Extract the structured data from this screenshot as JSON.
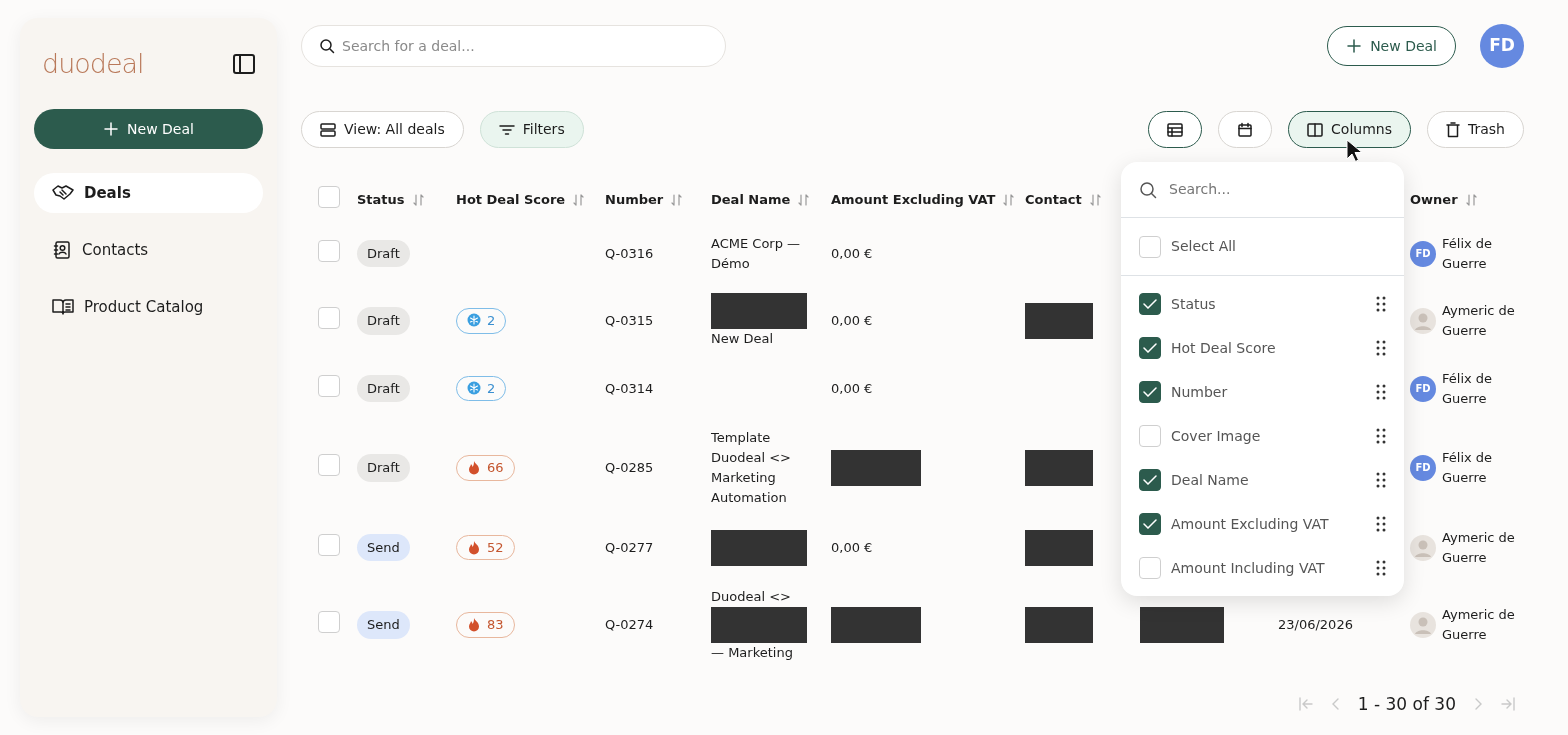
{
  "sidebar": {
    "logo": "duodeal",
    "new_deal": "New Deal",
    "items": [
      {
        "label": "Deals",
        "selected": true
      },
      {
        "label": "Contacts",
        "selected": false
      },
      {
        "label": "Product Catalog",
        "selected": false
      }
    ]
  },
  "search": {
    "placeholder": "Search for a deal..."
  },
  "new_deal": "New Deal",
  "user": {
    "initials": "FD"
  },
  "toolbar": {
    "view": "View: All deals",
    "filters": "Filters",
    "views": [
      {
        "kind": "table",
        "selected": true
      },
      {
        "kind": "calendar",
        "selected": false
      }
    ],
    "columns": {
      "label": "Columns",
      "selected": true
    },
    "trash": "Trash"
  },
  "table": {
    "header_checked": false,
    "columns": [
      "Status",
      "Hot Deal Score",
      "Number",
      "Deal Name",
      "Amount Excluding VAT",
      "Contact",
      "",
      "",
      "Owner"
    ],
    "rows": [
      {
        "selected": false,
        "status": {
          "kind": "draft",
          "label": "Draft"
        },
        "number": "Q-0316",
        "deal_name": [
          {
            "kind": "text",
            "text": "ACME Corp — Démo"
          }
        ],
        "amount": [
          {
            "kind": "text",
            "text": "0,00 €"
          }
        ],
        "contact": [],
        "column_7": [],
        "column_8": [],
        "owner": {
          "kind": "initials",
          "initials": "FD",
          "name": "Félix de Guerre"
        }
      },
      {
        "selected": false,
        "status": {
          "kind": "draft",
          "label": "Draft"
        },
        "score": {
          "kind": "cold",
          "value": "2"
        },
        "number": "Q-0315",
        "deal_name": [
          {
            "kind": "redaction"
          },
          {
            "kind": "text",
            "text": "New Deal"
          }
        ],
        "amount": [
          {
            "kind": "text",
            "text": "0,00 €"
          }
        ],
        "contact": [
          {
            "kind": "redaction"
          }
        ],
        "column_7": [],
        "column_8": [],
        "owner": {
          "kind": "photo",
          "name": "Aymeric de Guerre"
        }
      },
      {
        "selected": false,
        "status": {
          "kind": "draft",
          "label": "Draft"
        },
        "score": {
          "kind": "cold",
          "value": "2"
        },
        "number": "Q-0314",
        "deal_name": [],
        "amount": [
          {
            "kind": "text",
            "text": "0,00 €"
          }
        ],
        "contact": [],
        "column_7": [],
        "column_8": [],
        "owner": {
          "kind": "initials",
          "initials": "FD",
          "name": "Félix de Guerre"
        }
      },
      {
        "selected": false,
        "status": {
          "kind": "draft",
          "label": "Draft"
        },
        "score": {
          "kind": "hot",
          "value": "66"
        },
        "number": "Q-0285",
        "deal_name": [
          {
            "kind": "text",
            "text": "Template Duodeal <> Marketing Automation"
          }
        ],
        "amount": [
          {
            "kind": "redaction"
          }
        ],
        "contact": [
          {
            "kind": "redaction"
          }
        ],
        "column_7": [],
        "column_8": [],
        "owner": {
          "kind": "initials",
          "initials": "FD",
          "name": "Félix de Guerre"
        }
      },
      {
        "selected": false,
        "status": {
          "kind": "send",
          "label": "Send"
        },
        "score": {
          "kind": "hot",
          "value": "52"
        },
        "number": "Q-0277",
        "deal_name": [
          {
            "kind": "redaction"
          }
        ],
        "amount": [
          {
            "kind": "text",
            "text": "0,00 €"
          }
        ],
        "contact": [
          {
            "kind": "redaction"
          }
        ],
        "column_7": [],
        "column_8": [],
        "owner": {
          "kind": "photo",
          "name": "Aymeric de Guerre"
        }
      },
      {
        "selected": false,
        "status": {
          "kind": "send",
          "label": "Send"
        },
        "score": {
          "kind": "hot",
          "value": "83"
        },
        "number": "Q-0274",
        "deal_name": [
          {
            "kind": "text",
            "text": "Duodeal <>"
          },
          {
            "kind": "redaction"
          },
          {
            "kind": "text",
            "text": "— Marketing"
          }
        ],
        "amount": [
          {
            "kind": "redaction"
          }
        ],
        "contact": [
          {
            "kind": "redaction"
          }
        ],
        "column_7": [
          {
            "kind": "redaction"
          }
        ],
        "column_8": [
          {
            "kind": "text",
            "text": "23/06/2026"
          }
        ],
        "owner": {
          "kind": "photo",
          "name": "Aymeric de Guerre"
        }
      }
    ]
  },
  "columns_menu": {
    "placeholder": "Search...",
    "select_all": {
      "label": "Select All",
      "checked": false
    },
    "items": [
      {
        "label": "Status",
        "checked": true
      },
      {
        "label": "Hot Deal Score",
        "checked": true
      },
      {
        "label": "Number",
        "checked": true
      },
      {
        "label": "Cover Image",
        "checked": false
      },
      {
        "label": "Deal Name",
        "checked": true
      },
      {
        "label": "Amount Excluding VAT",
        "checked": true
      },
      {
        "label": "Amount Including VAT",
        "checked": false
      }
    ]
  },
  "pagination": {
    "range": "1 - 30 of 30",
    "first_disabled": true,
    "prev_disabled": true,
    "next_disabled": true,
    "last_disabled": true
  }
}
